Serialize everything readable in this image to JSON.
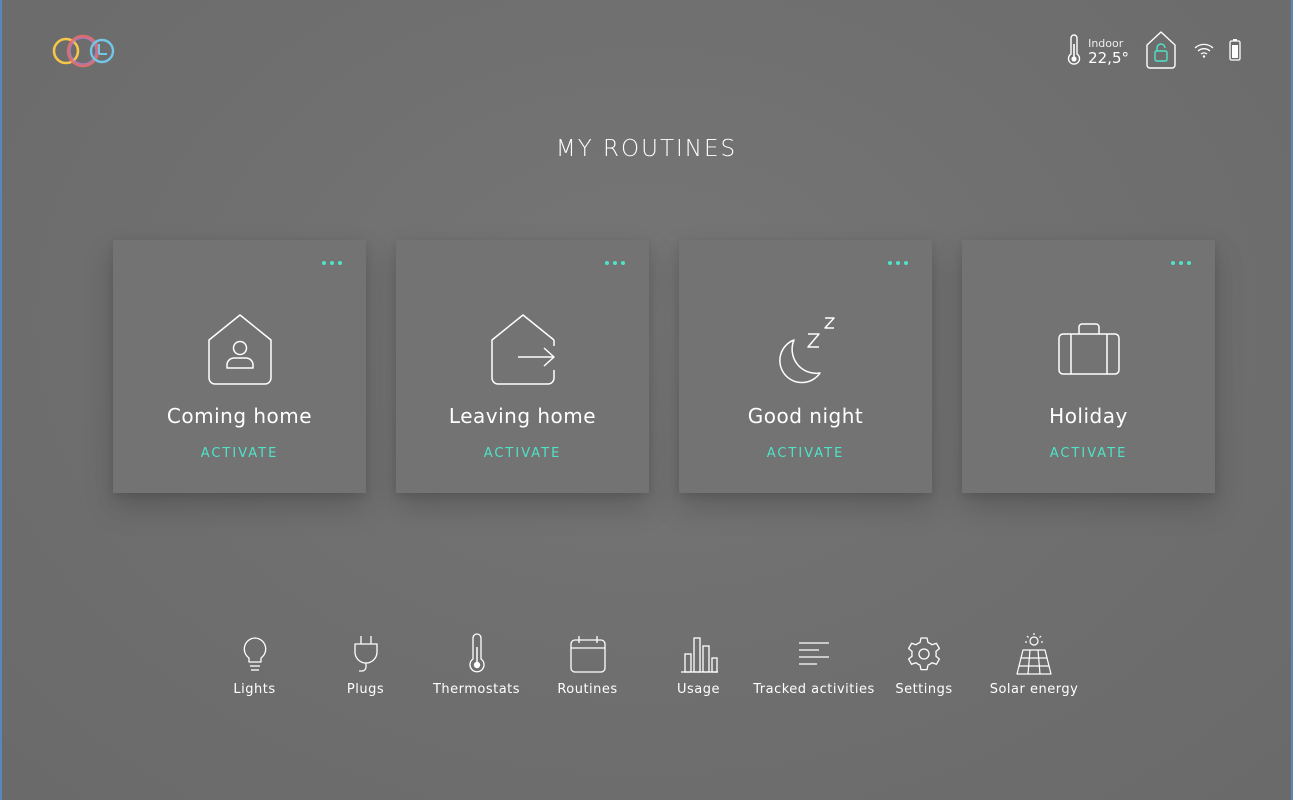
{
  "header": {
    "logo_icon": "three-rings-logo",
    "indoor_label": "Indoor",
    "indoor_value": "22,5°",
    "status_icons": [
      "thermometer-icon",
      "house-lock-icon",
      "wifi-icon",
      "battery-icon"
    ]
  },
  "page": {
    "title": "MY ROUTINES"
  },
  "colors": {
    "accent": "#4fe3c8",
    "background": "#6f6f6f",
    "card": "#737373"
  },
  "routines": [
    {
      "title": "Coming home",
      "action": "ACTIVATE",
      "icon": "house-person-icon"
    },
    {
      "title": "Leaving home",
      "action": "ACTIVATE",
      "icon": "house-exit-icon"
    },
    {
      "title": "Good night",
      "action": "ACTIVATE",
      "icon": "moon-zz-icon"
    },
    {
      "title": "Holiday",
      "action": "ACTIVATE",
      "icon": "suitcase-icon"
    }
  ],
  "nav": [
    {
      "label": "Lights",
      "icon": "bulb-icon"
    },
    {
      "label": "Plugs",
      "icon": "plug-icon"
    },
    {
      "label": "Thermostats",
      "icon": "thermometer-icon"
    },
    {
      "label": "Routines",
      "icon": "calendar-icon"
    },
    {
      "label": "Usage",
      "icon": "bar-chart-icon"
    },
    {
      "label": "Tracked activities",
      "icon": "lines-icon"
    },
    {
      "label": "Settings",
      "icon": "gear-icon"
    },
    {
      "label": "Solar energy",
      "icon": "solar-panel-icon"
    }
  ]
}
